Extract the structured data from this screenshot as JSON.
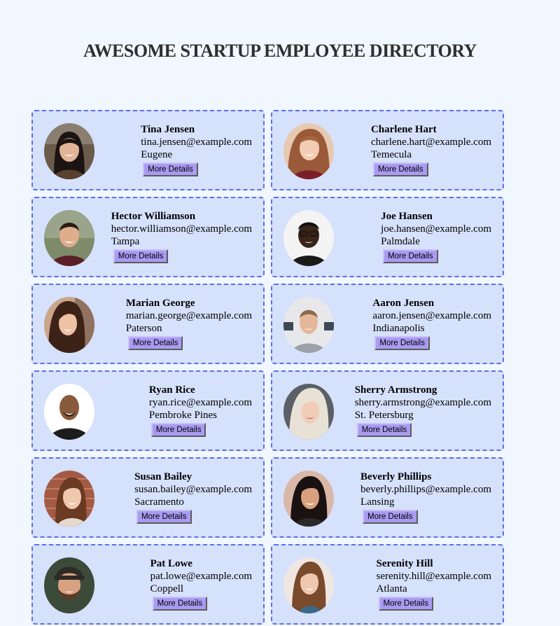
{
  "header": {
    "title": "AWESOME STARTUP EMPLOYEE DIRECTORY"
  },
  "button_label": "More Details",
  "employees": [
    {
      "name": "Tina Jensen",
      "email": "tina.jensen@example.com",
      "city": "Eugene"
    },
    {
      "name": "Charlene Hart",
      "email": "charlene.hart@example.com",
      "city": "Temecula"
    },
    {
      "name": "Hector Williamson",
      "email": "hector.williamson@example.com",
      "city": "Tampa"
    },
    {
      "name": "Joe Hansen",
      "email": "joe.hansen@example.com",
      "city": "Palmdale"
    },
    {
      "name": "Marian George",
      "email": "marian.george@example.com",
      "city": "Paterson"
    },
    {
      "name": "Aaron Jensen",
      "email": "aaron.jensen@example.com",
      "city": "Indianapolis"
    },
    {
      "name": "Ryan Rice",
      "email": "ryan.rice@example.com",
      "city": "Pembroke Pines"
    },
    {
      "name": "Sherry Armstrong",
      "email": "sherry.armstrong@example.com",
      "city": "St. Petersburg"
    },
    {
      "name": "Susan Bailey",
      "email": "susan.bailey@example.com",
      "city": "Sacramento"
    },
    {
      "name": "Beverly Phillips",
      "email": "beverly.phillips@example.com",
      "city": "Lansing"
    },
    {
      "name": "Pat Lowe",
      "email": "pat.lowe@example.com",
      "city": "Coppell"
    },
    {
      "name": "Serenity Hill",
      "email": "serenity.hill@example.com",
      "city": "Atlanta"
    }
  ],
  "colors": {
    "page_background": "#f1f7fe",
    "card_background": "#d6e1fb",
    "card_border": "#5d6ef0",
    "button_background": "#a99bf2"
  }
}
